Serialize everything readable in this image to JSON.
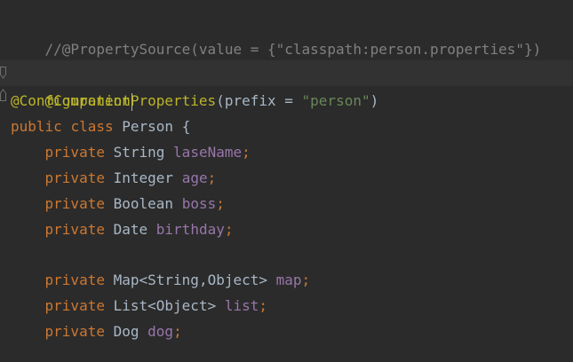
{
  "editor": {
    "lines": [
      {
        "id": 1,
        "text": "//@PropertySource(value = {\"classpath:person.properties\"})"
      },
      {
        "id": 3,
        "annotation": "@Component"
      },
      {
        "id": 4,
        "annotation": "@ConfigurationProperties",
        "open": "(",
        "param": "prefix",
        "eq": " = ",
        "value": "\"person\"",
        "close": ")"
      },
      {
        "id": 5,
        "kw1": "public",
        "kw2": "class",
        "name": "Person",
        "brace": "{"
      },
      {
        "id": 6,
        "kw": "private",
        "type": "String",
        "name": "laseName",
        "semi": ";"
      },
      {
        "id": 7,
        "kw": "private",
        "type": "Integer",
        "name": "age",
        "semi": ";"
      },
      {
        "id": 8,
        "kw": "private",
        "type": "Boolean",
        "name": "boss",
        "semi": ";"
      },
      {
        "id": 9,
        "kw": "private",
        "type": "Date",
        "name": "birthday",
        "semi": ";"
      },
      {
        "id": 11,
        "kw": "private",
        "type": "Map<String,Object>",
        "name": "map",
        "semi": ";"
      },
      {
        "id": 12,
        "kw": "private",
        "type": "List<Object>",
        "name": "list",
        "semi": ";"
      },
      {
        "id": 13,
        "kw": "private",
        "type": "Dog",
        "name": "dog",
        "semi": ";"
      }
    ]
  },
  "colors": {
    "background": "#2b2b2b",
    "current_line": "#323232",
    "comment": "#808080",
    "annotation": "#bbb529",
    "keyword": "#cc7832",
    "string": "#6a8759",
    "field": "#9876aa",
    "plain": "#a9b7c6"
  }
}
